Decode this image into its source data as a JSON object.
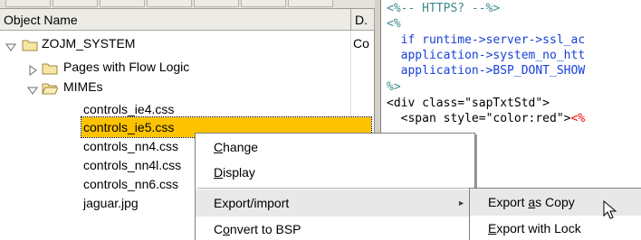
{
  "tree": {
    "header": {
      "object_name": "Object Name",
      "description": "D."
    },
    "root": {
      "label": "ZOJM_SYSTEM",
      "description": "Co"
    },
    "nodes": [
      {
        "label": "Pages with Flow Logic"
      },
      {
        "label": "MIMEs"
      }
    ],
    "files": [
      {
        "label": "controls_ie4.css"
      },
      {
        "label": "controls_ie5.css"
      },
      {
        "label": "controls_nn4.css"
      },
      {
        "label": "controls_nn4l.css"
      },
      {
        "label": "controls_nn6.css"
      },
      {
        "label": "jaguar.jpg"
      }
    ]
  },
  "code": {
    "lines": [
      {
        "text": "<%-- HTTPS? --%>",
        "kind": "comment"
      },
      {
        "text": "<%",
        "kind": "comment"
      },
      {
        "text": "  if runtime->server->ssl_ac",
        "kind": "code"
      },
      {
        "text": "  application->system_no_htt",
        "kind": "code"
      },
      {
        "text": "  application->BSP_DONT_SHOW",
        "kind": "code"
      },
      {
        "text": "%>",
        "kind": "comment"
      },
      {
        "text": "<div class=\"sapTxtStd\">",
        "kind": "html"
      },
      {
        "text": "  <span style=\"color:red\"><%",
        "kind": "mixed"
      }
    ]
  },
  "context_menu": {
    "items": [
      {
        "pre": "",
        "mnemonic": "C",
        "post": "hange"
      },
      {
        "pre": "",
        "mnemonic": "D",
        "post": "isplay"
      },
      {
        "pre": "Export/import",
        "mnemonic": "",
        "post": ""
      },
      {
        "pre": "C",
        "mnemonic": "o",
        "post": "nvert to BSP"
      }
    ]
  },
  "submenu": {
    "items": [
      {
        "pre": "Export ",
        "mnemonic": "a",
        "post": "s Copy"
      },
      {
        "pre": "",
        "mnemonic": "E",
        "post": "xport with Lock"
      }
    ]
  },
  "colors": {
    "selection": "#fdc300",
    "code_keyword": "#1840d8",
    "code_comment": "#3a8a88",
    "code_string_red": "#ff0000"
  }
}
